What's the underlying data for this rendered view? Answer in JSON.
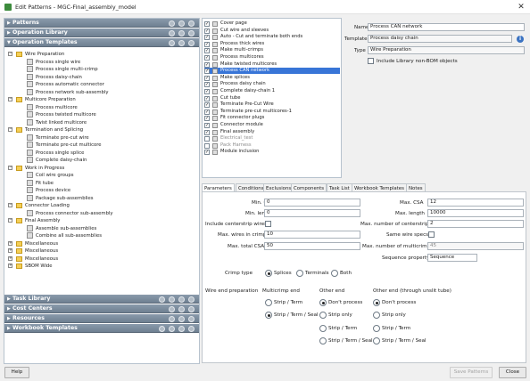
{
  "window": {
    "title": "Edit Patterns - MGC-Final_assembly_model"
  },
  "left_panel": {
    "sections_top": [
      "Patterns",
      "Operation Library",
      "Operation Templates"
    ],
    "sections_bottom": [
      "Task Library",
      "Cost Centers",
      "Resources",
      "Workbook Templates"
    ],
    "tree": [
      {
        "label": "Wire Preparation",
        "level": 0,
        "kind": "folder",
        "exp": "−"
      },
      {
        "label": "Process single wire",
        "level": 1,
        "kind": "item"
      },
      {
        "label": "Process single multi-crimp",
        "level": 1,
        "kind": "item"
      },
      {
        "label": "Process daisy-chain",
        "level": 1,
        "kind": "item"
      },
      {
        "label": "Process automatic connector",
        "level": 1,
        "kind": "item"
      },
      {
        "label": "Process network sub-assembly",
        "level": 1,
        "kind": "item"
      },
      {
        "label": "Multicore Preparation",
        "level": 0,
        "kind": "folder",
        "exp": "−"
      },
      {
        "label": "Process multicore",
        "level": 1,
        "kind": "item"
      },
      {
        "label": "Process twisted multicore",
        "level": 1,
        "kind": "item"
      },
      {
        "label": "Twist linked multicore",
        "level": 1,
        "kind": "item"
      },
      {
        "label": "Termination and Splicing",
        "level": 0,
        "kind": "folder",
        "exp": "−"
      },
      {
        "label": "Terminate pre-cut wire",
        "level": 1,
        "kind": "item"
      },
      {
        "label": "Terminate pre-cut multicore",
        "level": 1,
        "kind": "item"
      },
      {
        "label": "Process single splice",
        "level": 1,
        "kind": "item"
      },
      {
        "label": "Complete daisy-chain",
        "level": 1,
        "kind": "item"
      },
      {
        "label": "Work in Progress",
        "level": 0,
        "kind": "folder",
        "exp": "−"
      },
      {
        "label": "Coil wire groups",
        "level": 1,
        "kind": "item"
      },
      {
        "label": "Fit tube",
        "level": 1,
        "kind": "item"
      },
      {
        "label": "Process device",
        "level": 1,
        "kind": "item"
      },
      {
        "label": "Package sub-assemblies",
        "level": 1,
        "kind": "item"
      },
      {
        "label": "Connector Loading",
        "level": 0,
        "kind": "folder",
        "exp": "−"
      },
      {
        "label": "Process connector sub-assembly",
        "level": 1,
        "kind": "item"
      },
      {
        "label": "Final Assembly",
        "level": 0,
        "kind": "folder",
        "exp": "−"
      },
      {
        "label": "Assemble sub-assemblies",
        "level": 1,
        "kind": "item"
      },
      {
        "label": "Combine all sub-assemblies",
        "level": 1,
        "kind": "item"
      },
      {
        "label": "Miscellaneous",
        "level": 0,
        "kind": "folder",
        "exp": "+"
      },
      {
        "label": "Miscellaneous",
        "level": 0,
        "kind": "folder",
        "exp": "+"
      },
      {
        "label": "Miscellaneous",
        "level": 0,
        "kind": "folder",
        "exp": "+"
      },
      {
        "label": "SBOM Wide",
        "level": 0,
        "kind": "folder",
        "exp": "+"
      }
    ]
  },
  "middle_list": [
    {
      "label": "Cover page",
      "checked": true,
      "selected": false,
      "grayed": false
    },
    {
      "label": "Cut wire and sleeves",
      "checked": true,
      "selected": false,
      "grayed": false
    },
    {
      "label": "Auto - Cut and terminate both ends",
      "checked": true,
      "selected": false,
      "grayed": false
    },
    {
      "label": "Process thick wires",
      "checked": true,
      "selected": false,
      "grayed": false
    },
    {
      "label": "Make multi-crimps",
      "checked": true,
      "selected": false,
      "grayed": false
    },
    {
      "label": "Process multicores",
      "checked": true,
      "selected": false,
      "grayed": false
    },
    {
      "label": "Make twisted multicores",
      "checked": true,
      "selected": false,
      "grayed": false
    },
    {
      "label": "Process CAN network",
      "checked": true,
      "selected": true,
      "grayed": false
    },
    {
      "label": "Make splices",
      "checked": true,
      "selected": false,
      "grayed": false
    },
    {
      "label": "Process daisy chain",
      "checked": true,
      "selected": false,
      "grayed": false
    },
    {
      "label": "Complete daisy-chain 1",
      "checked": true,
      "selected": false,
      "grayed": false
    },
    {
      "label": "Cut tube",
      "checked": true,
      "selected": false,
      "grayed": false
    },
    {
      "label": "Terminate Pre-Cut Wire",
      "checked": true,
      "selected": false,
      "grayed": false
    },
    {
      "label": "Terminate pre-cut multicores-1",
      "checked": true,
      "selected": false,
      "grayed": false
    },
    {
      "label": "Fit connector plugs",
      "checked": true,
      "selected": false,
      "grayed": false
    },
    {
      "label": "Connector module",
      "checked": true,
      "selected": false,
      "grayed": false
    },
    {
      "label": "Final assembly",
      "checked": true,
      "selected": false,
      "grayed": false
    },
    {
      "label": "Electrical_test",
      "checked": false,
      "selected": false,
      "grayed": true
    },
    {
      "label": "Pack Harness",
      "checked": false,
      "selected": false,
      "grayed": true
    },
    {
      "label": "Module inclusion",
      "checked": true,
      "selected": false,
      "grayed": false
    }
  ],
  "properties": {
    "name_label": "Name",
    "name_value": "Process CAN network",
    "template_label": "Template",
    "template_value": "Process daisy chain",
    "type_label": "Type",
    "type_value": "Wire Preparation",
    "include_label": "Include Library non-BOM objects"
  },
  "tabs": [
    "Parameters",
    "Conditions",
    "Exclusions",
    "Components",
    "Task List",
    "Workbook Templates",
    "Notes"
  ],
  "params": {
    "min_csa_label": "Min. CSA",
    "min_csa": "0",
    "max_csa_label": "Max. CSA",
    "max_csa": "12",
    "min_length_label": "Min. length",
    "min_length": "0",
    "max_length_label": "Max. length",
    "max_length": "10000",
    "include_centerstrip_label": "Include centerstrip wires",
    "max_centerstrips_label": "Max. number of centerstrips",
    "max_centerstrips": "2",
    "max_wires_crimp_label": "Max. wires in crimp",
    "max_wires_crimp": "10",
    "same_wire_specs_label": "Same wire specs",
    "max_total_csa_label": "Max. total CSA",
    "max_total_csa": "50",
    "max_multicrimps_label": "Max. number of multicrimps",
    "max_multicrimps": "45",
    "seq_prop_label": "Sequence property",
    "seq_prop": "Sequence",
    "crimp_type_label": "Crimp type",
    "crimp_opts": [
      "Splices",
      "Terminals",
      "Both"
    ],
    "wire_end_label": "Wire end preparation",
    "col_multicrimp": "Multicrimp end",
    "col_other": "Other end",
    "col_other_unsplit": "Other end (through unslit tube)",
    "multicrimp_opts": [
      "Strip / Term",
      "Strip / Term / Seal"
    ],
    "other_opts": [
      "Don't process",
      "Strip only",
      "Strip / Term",
      "Strip / Term / Seal"
    ],
    "unsplit_opts": [
      "Don't process",
      "Strip only",
      "Strip / Term",
      "Strip / Term / Seal"
    ]
  },
  "buttons": {
    "help": "Help",
    "save": "Save Patterns",
    "close": "Close"
  }
}
